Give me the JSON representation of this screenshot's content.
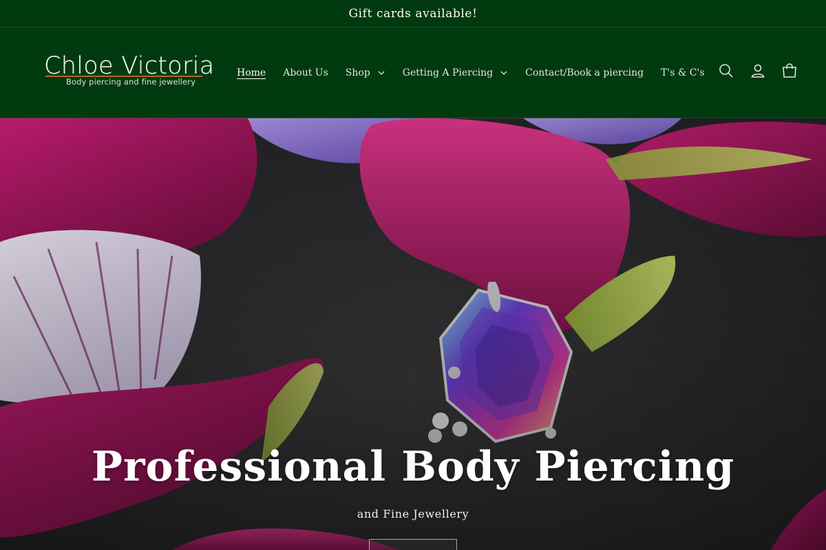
{
  "announcement": {
    "text": "Gift cards available!"
  },
  "brand": {
    "title": "Chloe Victoria",
    "subtitle": "Body piercing and fine jewellery"
  },
  "nav": {
    "items": [
      {
        "label": "Home",
        "active": true,
        "has_dropdown": false
      },
      {
        "label": "About Us",
        "active": false,
        "has_dropdown": false
      },
      {
        "label": "Shop",
        "active": false,
        "has_dropdown": true
      },
      {
        "label": "Getting A Piercing",
        "active": false,
        "has_dropdown": true
      },
      {
        "label": "Contact/Book a piercing",
        "active": false,
        "has_dropdown": false
      },
      {
        "label": "T's & C's",
        "active": false,
        "has_dropdown": false
      }
    ]
  },
  "header_icons": [
    "search-icon",
    "account-icon",
    "cart-icon"
  ],
  "hero": {
    "title": "Professional Body Piercing",
    "subtitle": "and Fine Jewellery",
    "button_label": ""
  },
  "colors": {
    "header_bg": "#003a0e",
    "text": "#ffffff",
    "petal_magenta": "#b0186a",
    "petal_violet": "#9a7ae0",
    "slate": "#2b2b2d"
  }
}
